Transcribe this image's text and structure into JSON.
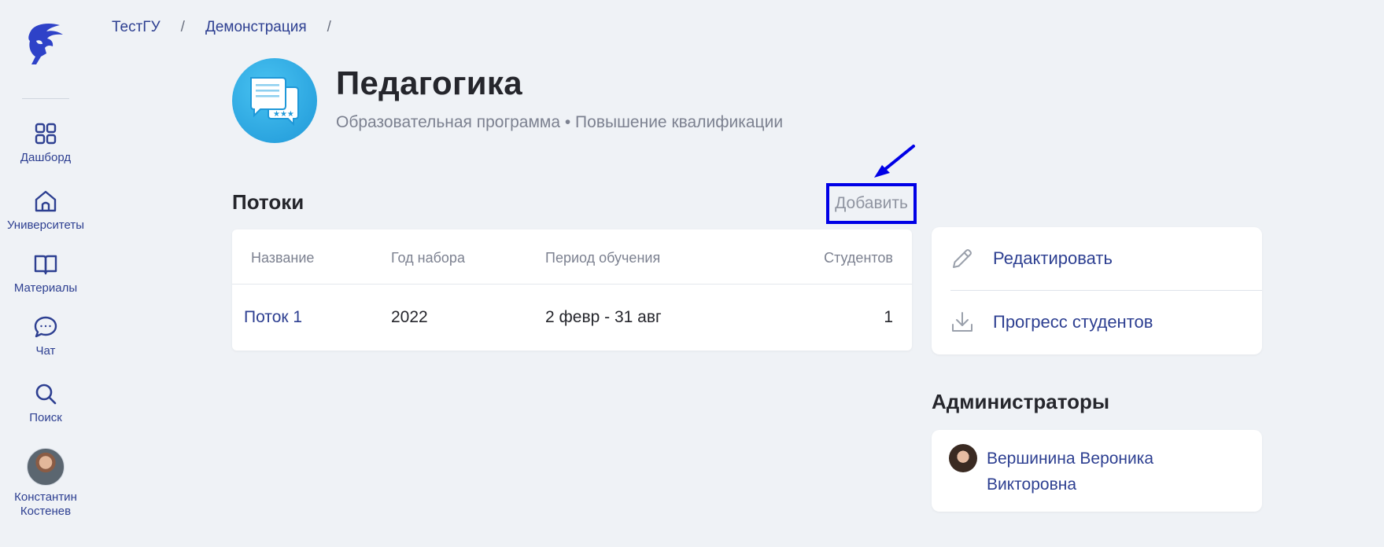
{
  "sidebar": {
    "items": [
      {
        "label": "Дашборд",
        "icon": "grid-icon"
      },
      {
        "label": "Университеты",
        "icon": "building-icon"
      },
      {
        "label": "Материалы",
        "icon": "book-icon"
      },
      {
        "label": "Чат",
        "icon": "chat-icon"
      },
      {
        "label": "Поиск",
        "icon": "search-icon"
      }
    ],
    "user": {
      "first_name": "Константин",
      "last_name": "Костенев"
    }
  },
  "breadcrumb": {
    "items": [
      "ТестГУ",
      "Демонстрация"
    ],
    "separator": "/"
  },
  "program": {
    "title": "Педагогика",
    "subtitle": "Образовательная программа • Повышение квалификации"
  },
  "streams": {
    "title": "Потоки",
    "add_label": "Добавить",
    "columns": [
      "Название",
      "Год набора",
      "Период обучения",
      "Студентов"
    ],
    "rows": [
      {
        "name": "Поток 1",
        "year": "2022",
        "period": "2 февр - 31 авг",
        "students": "1"
      }
    ]
  },
  "actions": {
    "items": [
      {
        "label": "Редактировать",
        "icon": "pencil-icon"
      },
      {
        "label": "Прогресс студентов",
        "icon": "download-icon"
      }
    ]
  },
  "admins": {
    "title": "Администраторы",
    "people": [
      {
        "name": "Вершинина Вероника Викторовна"
      }
    ]
  },
  "colors": {
    "accent": "#2d3f91",
    "background": "#eff2f6",
    "highlight": "#0000e6"
  }
}
